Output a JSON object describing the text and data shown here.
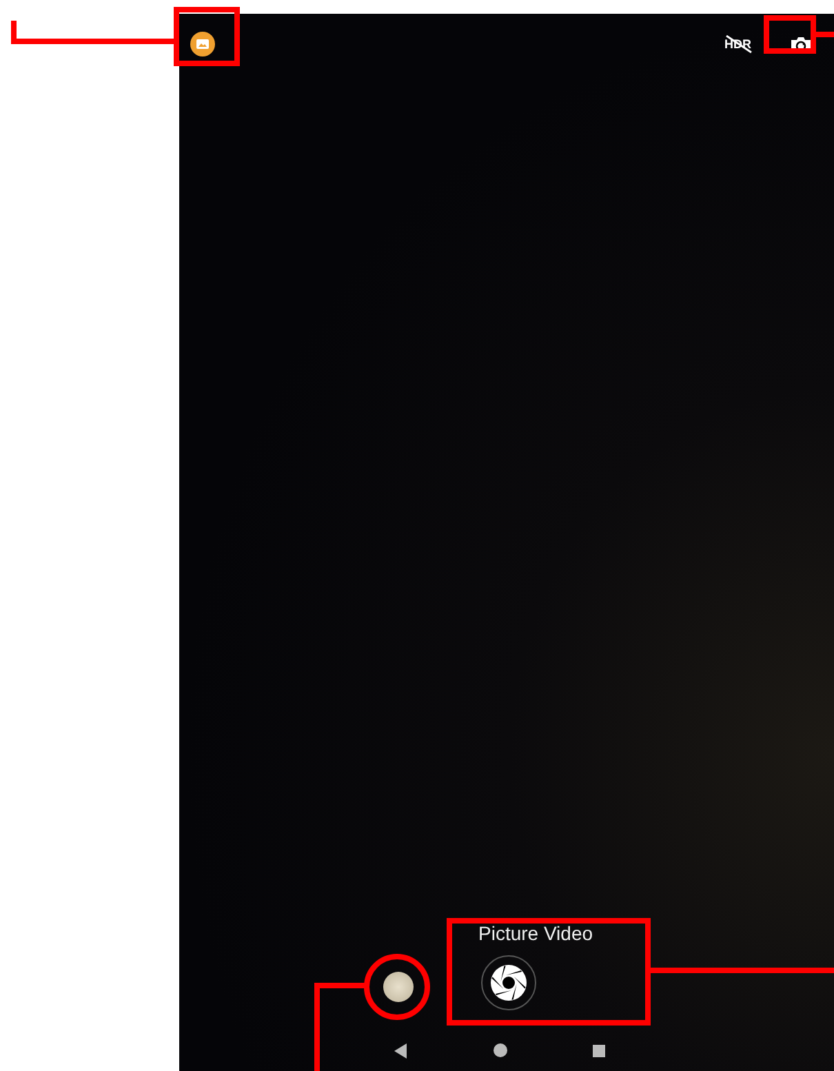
{
  "camera_screen": {
    "hdr_label": "HDR",
    "mode_labels": "Picture Video"
  }
}
